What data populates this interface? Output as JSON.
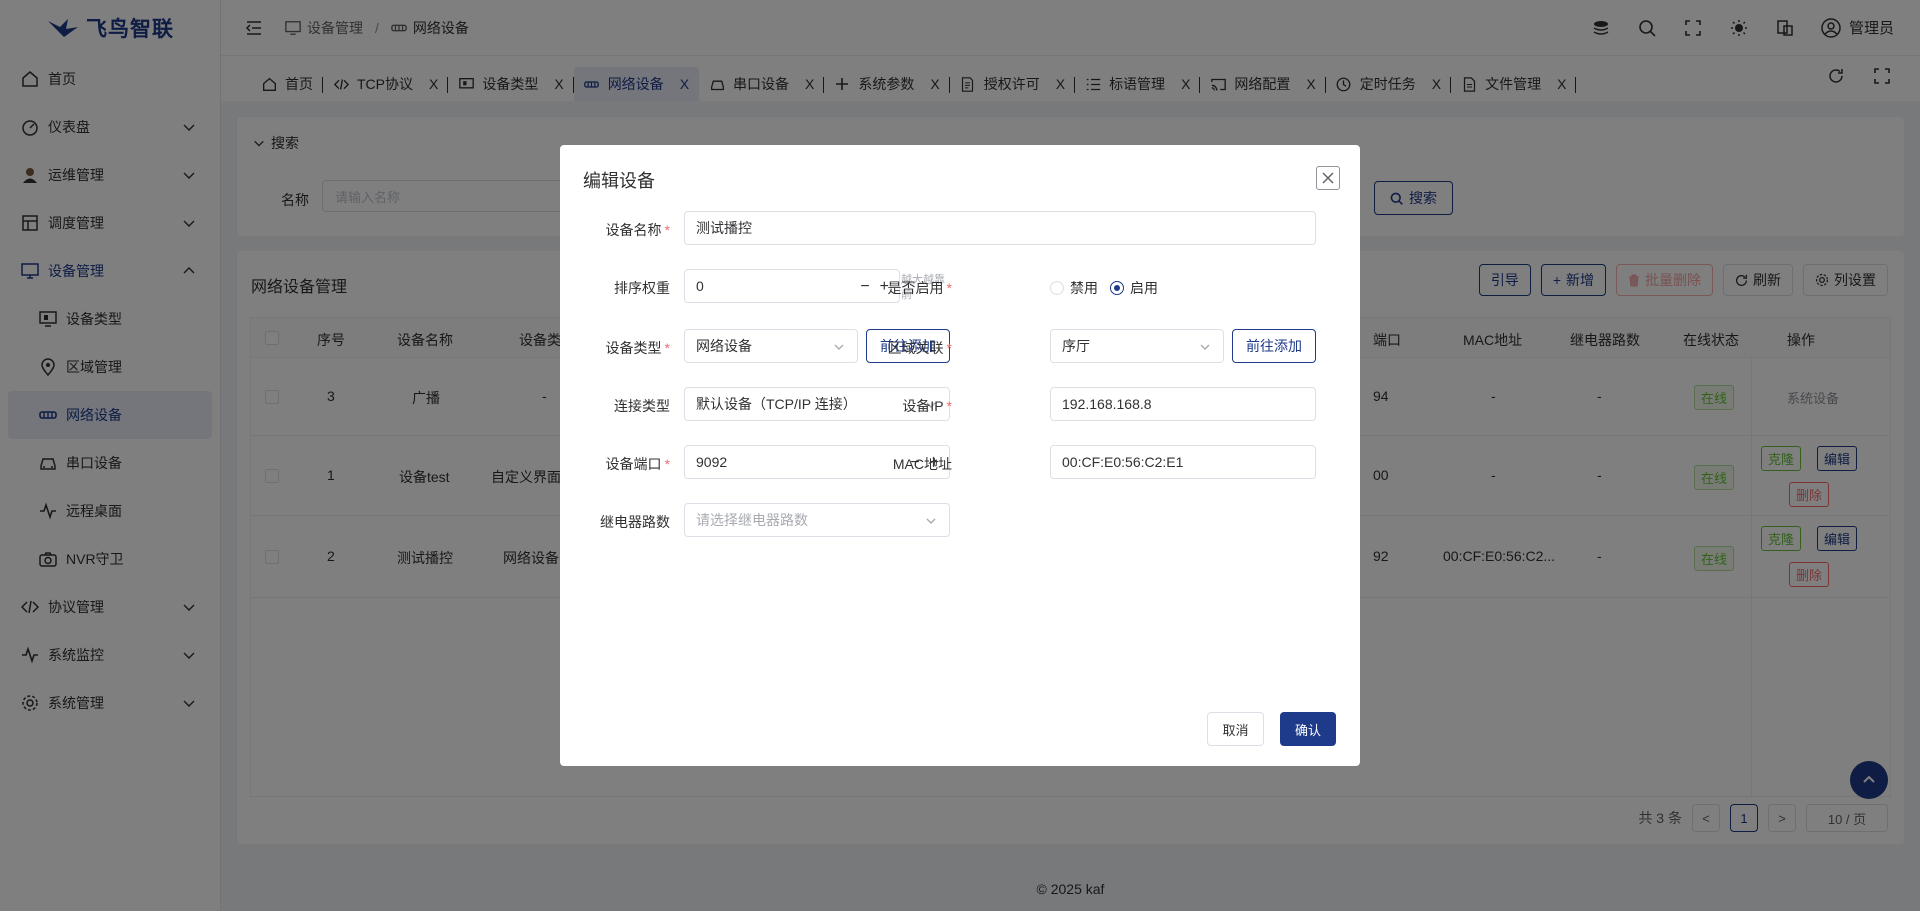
{
  "brand": {
    "name": "飞鸟智联",
    "color": "#1e3a8a"
  },
  "sidebar": {
    "items": [
      {
        "label": "首页",
        "icon": "home-icon"
      },
      {
        "label": "仪表盘",
        "icon": "dashboard-icon",
        "expandable": true
      },
      {
        "label": "运维管理",
        "icon": "operator-icon",
        "expandable": true
      },
      {
        "label": "调度管理",
        "icon": "schedule-icon",
        "expandable": true
      },
      {
        "label": "设备管理",
        "icon": "monitor-icon",
        "expandable": true,
        "open": true
      },
      {
        "label": "协议管理",
        "icon": "code-icon",
        "expandable": true
      },
      {
        "label": "系统监控",
        "icon": "pulse-icon",
        "expandable": true
      },
      {
        "label": "系统管理",
        "icon": "gear-icon",
        "expandable": true
      }
    ],
    "sub_items": [
      {
        "label": "设备类型",
        "icon": "device-type-icon"
      },
      {
        "label": "区域管理",
        "icon": "location-icon"
      },
      {
        "label": "网络设备",
        "icon": "network-icon",
        "active": true
      },
      {
        "label": "串口设备",
        "icon": "serial-icon"
      },
      {
        "label": "远程桌面",
        "icon": "pulse-icon"
      },
      {
        "label": "NVR守卫",
        "icon": "camera-icon"
      }
    ]
  },
  "header": {
    "breadcrumb": [
      "设备管理",
      "网络设备"
    ],
    "user": "管理员"
  },
  "tabs": [
    {
      "label": "首页",
      "icon": "home-icon",
      "closable": false
    },
    {
      "label": "TCP协议",
      "icon": "code-icon",
      "closable": true
    },
    {
      "label": "设备类型",
      "icon": "device-type-icon",
      "closable": true
    },
    {
      "label": "网络设备",
      "icon": "network-icon",
      "closable": true,
      "active": true
    },
    {
      "label": "串口设备",
      "icon": "serial-icon",
      "closable": true
    },
    {
      "label": "系统参数",
      "icon": "plus-icon",
      "closable": true
    },
    {
      "label": "授权许可",
      "icon": "license-icon",
      "closable": true
    },
    {
      "label": "标语管理",
      "icon": "list-icon",
      "closable": true
    },
    {
      "label": "网络配置",
      "icon": "cast-icon",
      "closable": true
    },
    {
      "label": "定时任务",
      "icon": "clock-icon",
      "closable": true
    },
    {
      "label": "文件管理",
      "icon": "file-icon",
      "closable": true
    }
  ],
  "tab_close": "X",
  "search": {
    "title": "搜索",
    "name_label": "名称",
    "name_placeholder": "请输入名称",
    "button": "搜索"
  },
  "table_card": {
    "title": "网络设备管理",
    "actions": {
      "guide": "引导",
      "add": "新增",
      "batch_delete": "批量删除",
      "refresh": "刷新",
      "columns": "列设置"
    },
    "headers": [
      "序号",
      "设备名称",
      "设备类",
      "端口",
      "MAC地址",
      "继电器路数",
      "在线状态",
      "操作"
    ],
    "rows": [
      {
        "seq": "3",
        "name": "广播",
        "type": "-",
        "port": "94",
        "mac": "-",
        "relay": "-",
        "status": "在线",
        "ops_text": "系统设备"
      },
      {
        "seq": "1",
        "name": "设备test",
        "type": "自定义界面",
        "port": "00",
        "mac": "-",
        "relay": "-",
        "status": "在线",
        "ops": [
          "克隆",
          "编辑",
          "删除"
        ]
      },
      {
        "seq": "2",
        "name": "测试播控",
        "type": "网络设备",
        "port": "92",
        "mac": "00:CF:E0:56:C2...",
        "relay": "-",
        "status": "在线",
        "ops": [
          "克隆",
          "编辑",
          "删除"
        ]
      }
    ]
  },
  "pagination": {
    "total": "共 3 条",
    "current": "1",
    "prev": "<",
    "next": ">",
    "page_size": "10 / 页"
  },
  "footer": "© 2025 kaf",
  "dialog": {
    "title": "编辑设备",
    "fields": {
      "device_name": {
        "label": "设备名称",
        "value": "测试播控"
      },
      "sort_weight": {
        "label": "排序权重",
        "value": "0",
        "hint": "越大越靠前"
      },
      "enabled": {
        "label": "是否启用",
        "options": [
          "禁用",
          "启用"
        ],
        "selected": "启用"
      },
      "device_type": {
        "label": "设备类型",
        "value": "网络设备",
        "add_button": "前往添加"
      },
      "area": {
        "label": "区域关联",
        "value": "序厅",
        "add_button": "前往添加"
      },
      "conn_type": {
        "label": "连接类型",
        "value": "默认设备（TCP/IP 连接）"
      },
      "device_ip": {
        "label": "设备IP",
        "value": "192.168.168.8"
      },
      "device_port": {
        "label": "设备端口",
        "value": "9092"
      },
      "mac": {
        "label": "MAC地址",
        "value": "00:CF:E0:56:C2:E1"
      },
      "relay": {
        "label": "继电器路数",
        "placeholder": "请选择继电器路数"
      }
    },
    "cancel": "取消",
    "confirm": "确认"
  }
}
